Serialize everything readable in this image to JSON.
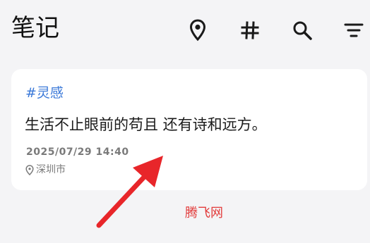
{
  "header": {
    "title": "笔记",
    "icons": [
      "location-pin-icon",
      "hashtag-icon",
      "search-icon",
      "filter-icon"
    ]
  },
  "note": {
    "tag": "#灵感",
    "content": "生活不止眼前的苟且 还有诗和远方。",
    "datetime": "2025/07/29 14:40",
    "location": "深圳市"
  },
  "overlay": {
    "watermark": "腾飞网",
    "arrow_color": "#e8262a"
  },
  "colors": {
    "background": "#f4f4f6",
    "card": "#ffffff",
    "tag": "#3a78d8",
    "watermark": "#e23b3b"
  }
}
